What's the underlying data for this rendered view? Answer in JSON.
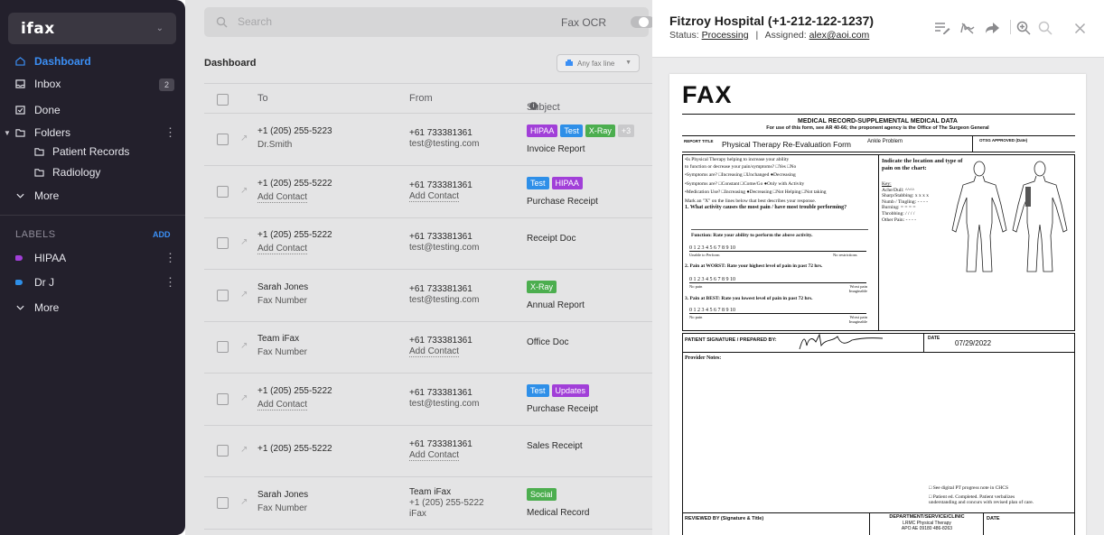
{
  "sidebar": {
    "logo": "ifax",
    "nav": [
      {
        "label": "Dashboard",
        "icon": "home-icon"
      },
      {
        "label": "Inbox",
        "icon": "inbox-icon",
        "badge": "2"
      },
      {
        "label": "Done",
        "icon": "done-icon"
      },
      {
        "label": "Folders",
        "icon": "folder-icon"
      },
      {
        "label": "Patient Records",
        "icon": "folder-icon"
      },
      {
        "label": "Radiology",
        "icon": "folder-icon"
      },
      {
        "label": "More",
        "icon": "chevron-down-icon"
      }
    ],
    "labels_heading": "LABELS",
    "labels_add": "ADD",
    "labels": [
      {
        "label": "HIPAA",
        "color": "#a13fd8"
      },
      {
        "label": "Dr J",
        "color": "#2e8fe8"
      }
    ],
    "labels_more": "More"
  },
  "main": {
    "search_placeholder": "Search",
    "fax_ocr_label": "Fax OCR",
    "title": "Dashboard",
    "fax_line_select": "Any fax line",
    "columns": {
      "to": "To",
      "from": "From",
      "subject": "Subject"
    },
    "rows": [
      {
        "to1": "+1 (205) 255-5223",
        "to2": "Dr.Smith",
        "from1": "+61 733381361",
        "from2": "test@testing.com",
        "from3": "",
        "tags": [
          "HIPAA",
          "Test",
          "X-Ray",
          "+3"
        ],
        "subject": "Invoice Report"
      },
      {
        "to1": "+1 (205) 255-5222",
        "to2": "Add Contact",
        "from1": "+61 733381361",
        "from2": "Add Contact",
        "from3": "",
        "tags": [
          "Test",
          "HIPAA"
        ],
        "subject": "Purchase Receipt"
      },
      {
        "to1": "+1 (205) 255-5222",
        "to2": "Add Contact",
        "from1": "+61 733381361",
        "from2": "test@testing.com",
        "from3": "",
        "tags": [],
        "subject": "Receipt Doc"
      },
      {
        "to1": "Sarah Jones",
        "to2": "Fax Number",
        "from1": "+61 733381361",
        "from2": "test@testing.com",
        "from3": "",
        "tags": [
          "X-Ray"
        ],
        "subject": "Annual Report"
      },
      {
        "to1": "Team iFax",
        "to2": "Fax Number",
        "from1": "+61 733381361",
        "from2": "Add Contact",
        "from3": "",
        "tags": [],
        "subject": "Office Doc"
      },
      {
        "to1": "+1 (205) 255-5222",
        "to2": "Add Contact",
        "from1": "+61 733381361",
        "from2": "test@testing.com",
        "from3": "",
        "tags": [
          "Test",
          "Updates"
        ],
        "subject": "Purchase Receipt"
      },
      {
        "to1": "+1 (205) 255-5222",
        "to2": "",
        "from1": "+61 733381361",
        "from2": "Add Contact",
        "from3": "",
        "tags": [],
        "subject": "Sales Receipt"
      },
      {
        "to1": "Sarah Jones",
        "to2": "Fax Number",
        "from1": "Team iFax",
        "from2": "+1 (205) 255-5222",
        "from3": "iFax",
        "tags": [
          "Social"
        ],
        "subject": "Medical Record"
      }
    ],
    "tag_colors": {
      "HIPAA": "#a13fd8",
      "Test": "#2e8fe8",
      "X-Ray": "#4cae4f",
      "+3": "#c9c9cb",
      "Updates": "#a13fd8",
      "Social": "#4cae4f"
    }
  },
  "viewer": {
    "title": "Fitzroy Hospital (+1-212-122-1237)",
    "status_label": "Status:",
    "status_value": "Processing",
    "sep": "|",
    "assigned_label": "Assigned:",
    "assigned_value": "alex@aoi.com",
    "tools": [
      "edit-list-icon",
      "signature-icon",
      "forward-icon",
      "zoom-in-icon",
      "zoom-out-icon",
      "close-icon"
    ],
    "doc": {
      "fax_title": "FAX",
      "form_title": "MEDICAL RECORD-SUPPLEMENTAL MEDICAL DATA",
      "form_sub": "For use of this form, see AR 40-66; the proponent agency is the Office of The Surgeon General",
      "report_title_label": "REPORT TITLE",
      "report_title": "Physical Therapy Re-Evaluation Form",
      "report_problem": "Ankle Problem",
      "otsg": "OTSG APPROVED (Date)",
      "q_lines": [
        "•Is Physical Therapy helping to increase your ability",
        "  to function or decrease your pain/symptoms?        □Yes        □No",
        "•Symptoms are?   □Increasing   □Unchanged   ●Decreasing",
        "•Symptoms are?   □Constant      □Come/Go     ●Only with Activity",
        "•Medication Use? □Increasing  ●Decreasing  □Not Helping  □Not taking",
        "Mark an \"X\" on the lines below that best describes your response."
      ],
      "q1": "1. What activity causes the most pain / have most trouble performing?",
      "function_line": "Function: Rate your ability to perform the above activity.",
      "scale": "0     1     2     3     4     5     6     7     8     9     10",
      "scale_l1": "Unable to Perform",
      "scale_r1": "No restrictions",
      "q2": "2. Pain at WORST: Rate your highest level of pain in past 72 hrs.",
      "scale_l2": "No pain",
      "scale_r2": "Worst pain Imaginable",
      "q3": "3. Pain at BEST:  Rate you lowest level of pain in past 72 hrs.",
      "chart_title": "Indicate the location and type of pain on the chart:",
      "key_lines": [
        "Key:",
        "Ache/Dull: ^^^^",
        "Sharp/Stabbing: x x x x",
        "Numb / Tingling: - - - -",
        "Burning: = = = =",
        "Throbbing: / / / /",
        "Other Pain: - - - -"
      ],
      "signature_label": "PATIENT SIGNATURE / PREPARED BY:",
      "date_label": "DATE",
      "date_value": "07/29/2022",
      "provider_notes": "Provider Notes:",
      "notes_lines": [
        "□ See digital PT progress note in CHCS",
        "□ Patient ed. Completed. Patient verbalizes",
        "understanding and concurs with revised plan of care."
      ],
      "reviewed_by": "REVIEWED BY (Signature & Title)",
      "dept_label": "DEPARTMENT/SERVICE/CLINIC",
      "dept_value1": "LRMC Physical Therapy",
      "dept_value2": "APO AE 09180  486-8263",
      "date_label2": "DATE"
    }
  }
}
